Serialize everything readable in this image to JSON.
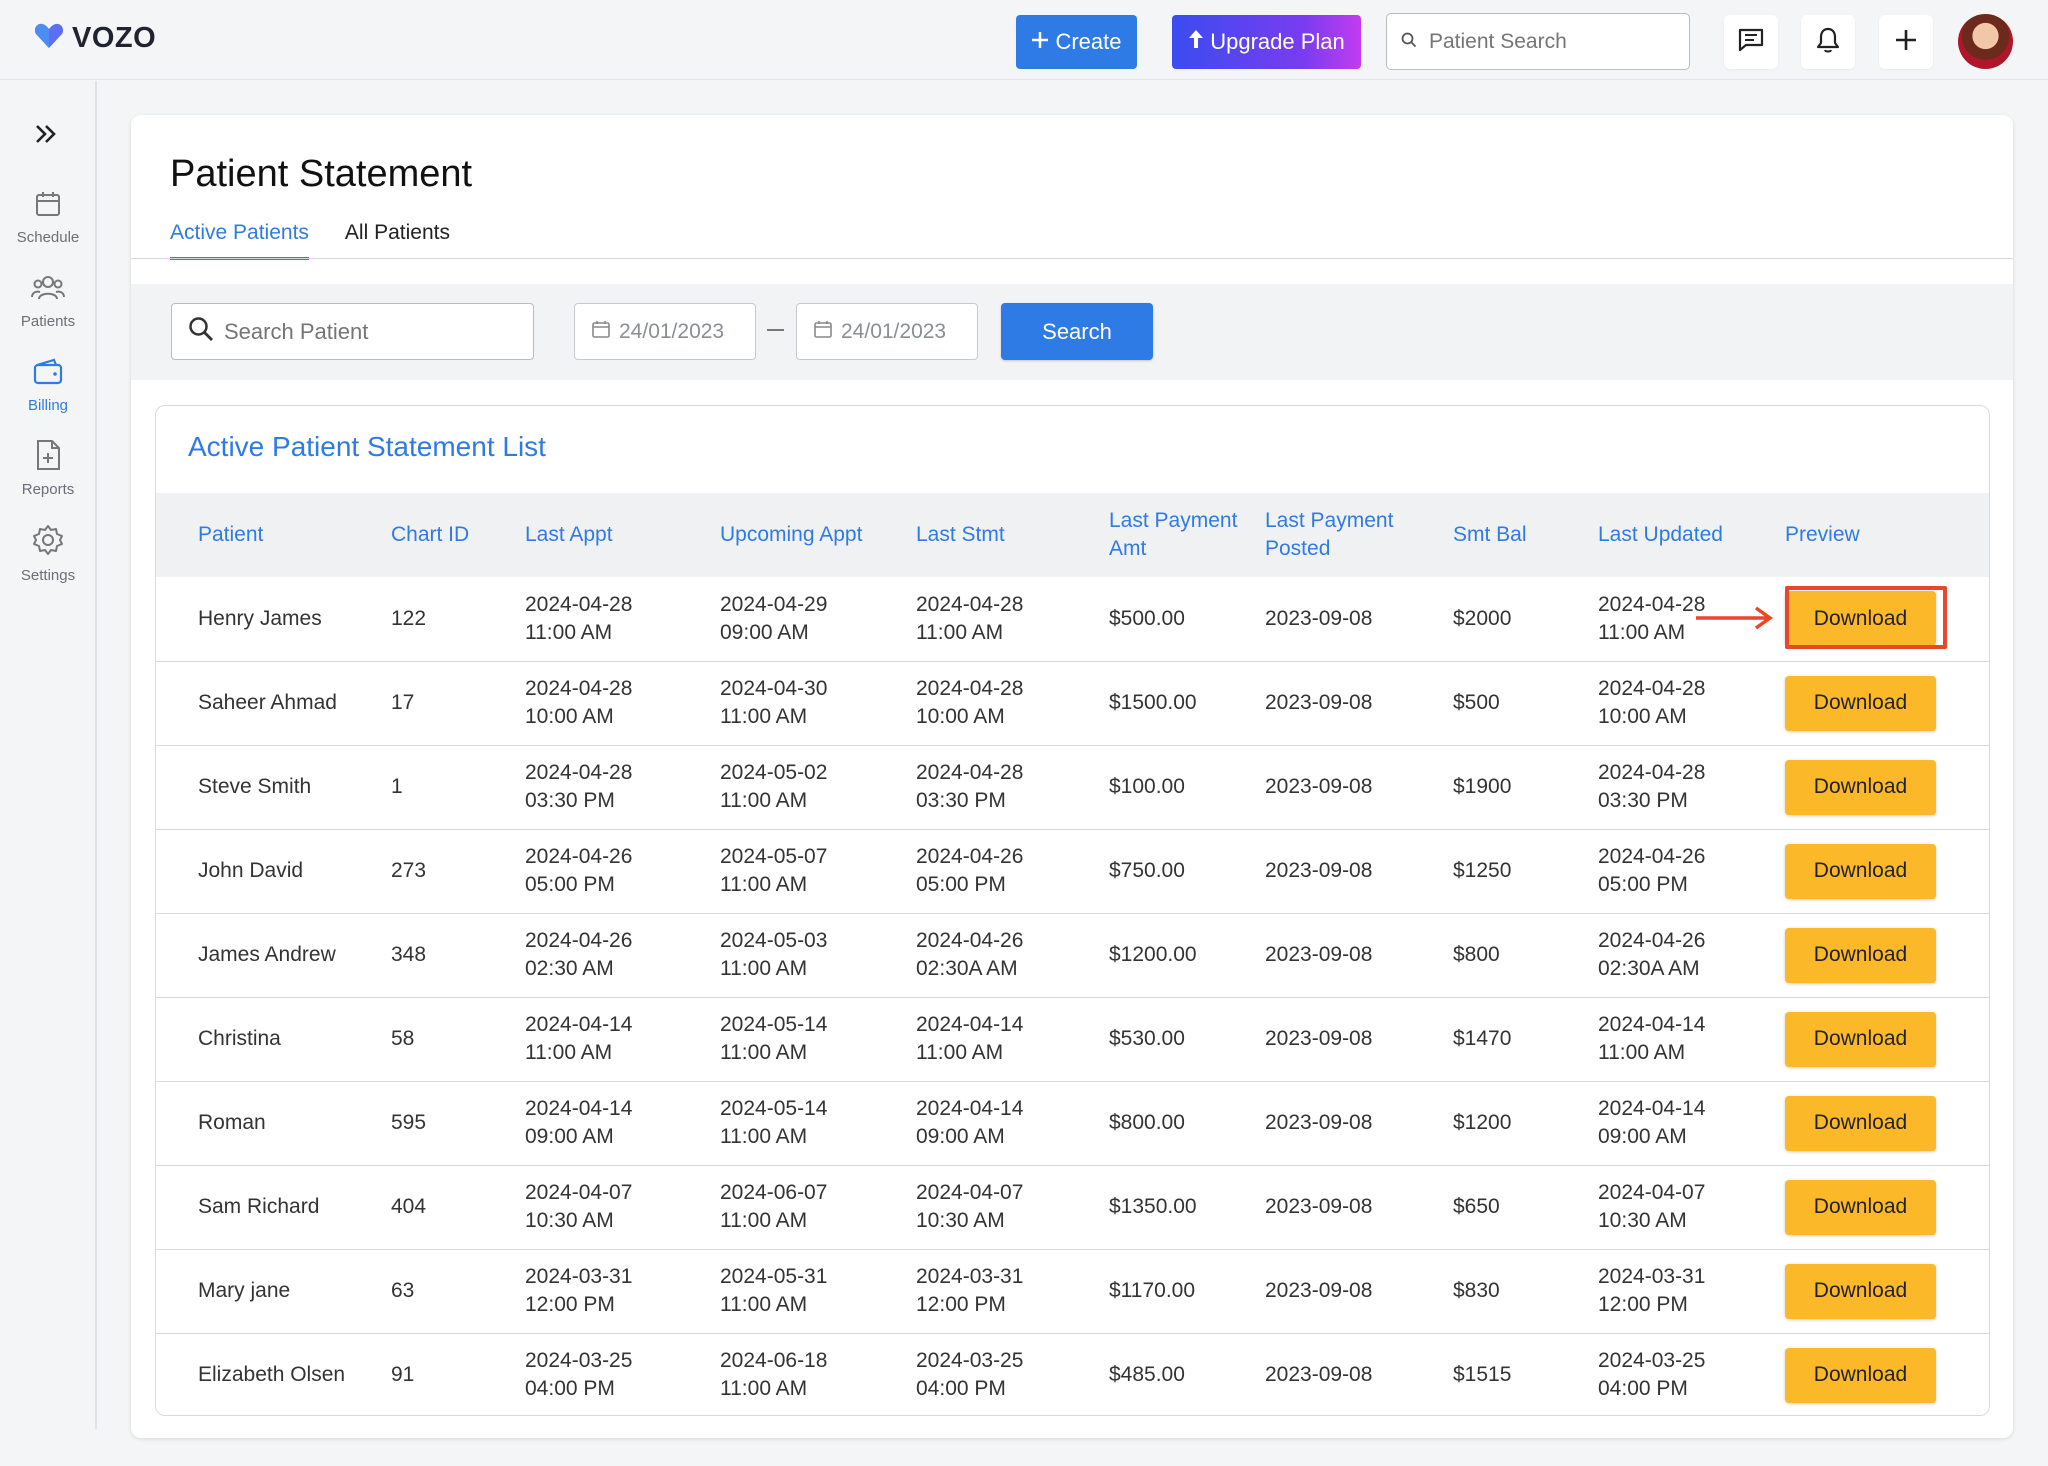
{
  "app": {
    "logo_text": "VOZO",
    "brand_color": "#2f7be6"
  },
  "topbar": {
    "create_label": "Create",
    "upgrade_label": "Upgrade Plan",
    "search_placeholder": "Patient Search",
    "icons": [
      "chat-icon",
      "bell-icon",
      "plus-icon"
    ]
  },
  "sidebar": {
    "items": [
      {
        "label": "Schedule",
        "icon": "calendar-icon"
      },
      {
        "label": "Patients",
        "icon": "users-icon"
      },
      {
        "label": "Billing",
        "icon": "wallet-icon",
        "active": true
      },
      {
        "label": "Reports",
        "icon": "document-plus-icon"
      },
      {
        "label": "Settings",
        "icon": "gear-icon"
      }
    ]
  },
  "page": {
    "title": "Patient Statement",
    "tabs": [
      {
        "label": "Active Patients",
        "active": true
      },
      {
        "label": "All Patients",
        "active": false
      }
    ]
  },
  "filters": {
    "search_placeholder": "Search Patient",
    "date_from": "24/01/2023",
    "date_to": "24/01/2023",
    "search_button": "Search"
  },
  "list": {
    "title": "Active Patient Statement List",
    "columns": [
      "Patient",
      "Chart ID",
      "Last Appt",
      "Upcoming Appt",
      "Last Stmt",
      "Last Payment Amt",
      "Last Payment Posted",
      "Smt Bal",
      "Last Updated",
      "Preview"
    ],
    "download_label": "Download",
    "rows": [
      {
        "patient": "Henry James",
        "chart_id": "122",
        "last_appt_date": "2024-04-28",
        "last_appt_time": "11:00 AM",
        "upcoming_date": "2024-04-29",
        "upcoming_time": "09:00 AM",
        "stmt_date": "2024-04-28",
        "stmt_time": "11:00 AM",
        "pay_amt": "$500.00",
        "pay_posted": "2023-09-08",
        "bal": "$2000",
        "upd_date": "2024-04-28",
        "upd_time": "11:00 AM"
      },
      {
        "patient": "Saheer Ahmad",
        "chart_id": "17",
        "last_appt_date": "2024-04-28",
        "last_appt_time": "10:00 AM",
        "upcoming_date": "2024-04-30",
        "upcoming_time": "11:00 AM",
        "stmt_date": "2024-04-28",
        "stmt_time": "10:00 AM",
        "pay_amt": "$1500.00",
        "pay_posted": "2023-09-08",
        "bal": "$500",
        "upd_date": "2024-04-28",
        "upd_time": "10:00 AM"
      },
      {
        "patient": "Steve Smith",
        "chart_id": "1",
        "last_appt_date": "2024-04-28",
        "last_appt_time": "03:30 PM",
        "upcoming_date": "2024-05-02",
        "upcoming_time": "11:00 AM",
        "stmt_date": "2024-04-28",
        "stmt_time": "03:30 PM",
        "pay_amt": "$100.00",
        "pay_posted": "2023-09-08",
        "bal": "$1900",
        "upd_date": "2024-04-28",
        "upd_time": "03:30 PM"
      },
      {
        "patient": "John David",
        "chart_id": "273",
        "last_appt_date": "2024-04-26",
        "last_appt_time": "05:00 PM",
        "upcoming_date": "2024-05-07",
        "upcoming_time": "11:00 AM",
        "stmt_date": "2024-04-26",
        "stmt_time": "05:00 PM",
        "pay_amt": "$750.00",
        "pay_posted": "2023-09-08",
        "bal": "$1250",
        "upd_date": "2024-04-26",
        "upd_time": "05:00 PM"
      },
      {
        "patient": "James Andrew",
        "chart_id": "348",
        "last_appt_date": "2024-04-26",
        "last_appt_time": "02:30 AM",
        "upcoming_date": "2024-05-03",
        "upcoming_time": "11:00 AM",
        "stmt_date": "2024-04-26",
        "stmt_time": "02:30A AM",
        "pay_amt": "$1200.00",
        "pay_posted": "2023-09-08",
        "bal": "$800",
        "upd_date": "2024-04-26",
        "upd_time": "02:30A AM"
      },
      {
        "patient": "Christina",
        "chart_id": "58",
        "last_appt_date": "2024-04-14",
        "last_appt_time": "11:00 AM",
        "upcoming_date": "2024-05-14",
        "upcoming_time": "11:00 AM",
        "stmt_date": "2024-04-14",
        "stmt_time": "11:00 AM",
        "pay_amt": "$530.00",
        "pay_posted": "2023-09-08",
        "bal": "$1470",
        "upd_date": "2024-04-14",
        "upd_time": "11:00 AM"
      },
      {
        "patient": "Roman",
        "chart_id": "595",
        "last_appt_date": "2024-04-14",
        "last_appt_time": "09:00 AM",
        "upcoming_date": "2024-05-14",
        "upcoming_time": "11:00 AM",
        "stmt_date": "2024-04-14",
        "stmt_time": "09:00 AM",
        "pay_amt": "$800.00",
        "pay_posted": "2023-09-08",
        "bal": "$1200",
        "upd_date": "2024-04-14",
        "upd_time": "09:00 AM"
      },
      {
        "patient": "Sam Richard",
        "chart_id": "404",
        "last_appt_date": "2024-04-07",
        "last_appt_time": "10:30 AM",
        "upcoming_date": "2024-06-07",
        "upcoming_time": "11:00 AM",
        "stmt_date": "2024-04-07",
        "stmt_time": "10:30 AM",
        "pay_amt": "$1350.00",
        "pay_posted": "2023-09-08",
        "bal": "$650",
        "upd_date": "2024-04-07",
        "upd_time": "10:30 AM"
      },
      {
        "patient": "Mary jane",
        "chart_id": "63",
        "last_appt_date": "2024-03-31",
        "last_appt_time": "12:00 PM",
        "upcoming_date": "2024-05-31",
        "upcoming_time": "11:00 AM",
        "stmt_date": "2024-03-31",
        "stmt_time": "12:00 PM",
        "pay_amt": "$1170.00",
        "pay_posted": "2023-09-08",
        "bal": "$830",
        "upd_date": "2024-03-31",
        "upd_time": "12:00 PM"
      },
      {
        "patient": "Elizabeth Olsen",
        "chart_id": "91",
        "last_appt_date": "2024-03-25",
        "last_appt_time": "04:00 PM",
        "upcoming_date": "2024-06-18",
        "upcoming_time": "11:00 AM",
        "stmt_date": "2024-03-25",
        "stmt_time": "04:00 PM",
        "pay_amt": "$485.00",
        "pay_posted": "2023-09-08",
        "bal": "$1515",
        "upd_date": "2024-03-25",
        "upd_time": "04:00 PM"
      }
    ]
  },
  "annotation": {
    "highlight_color": "#e8472a"
  }
}
